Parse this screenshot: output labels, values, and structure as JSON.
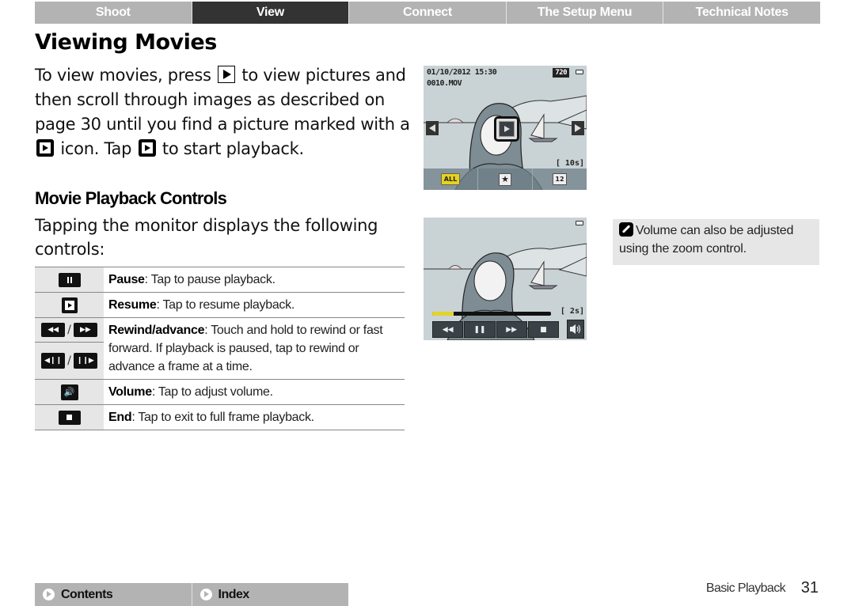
{
  "top_nav": {
    "tabs": [
      {
        "label": "Shoot",
        "active": false
      },
      {
        "label": "View",
        "active": true
      },
      {
        "label": "Connect",
        "active": false
      },
      {
        "label": "The Setup Menu",
        "active": false
      },
      {
        "label": "Technical Notes",
        "active": false
      }
    ]
  },
  "page_title": "Viewing Movies",
  "intro": {
    "part1": "To view movies, press",
    "part2": "to view pictures and then scroll through images as described on page 30 until you find a picture marked with a",
    "part3": "icon. Tap",
    "part4": "to start playback.",
    "icons": [
      "playback-button-icon",
      "movie-icon",
      "movie-icon"
    ]
  },
  "section": {
    "title": "Movie Playback Controls",
    "intro": "Tapping the monitor displays the following controls:"
  },
  "controls": [
    {
      "icon": "pause-icon",
      "name": "Pause",
      "desc": ": Tap to pause playback."
    },
    {
      "icon": "resume-icon",
      "name": "Resume",
      "desc": ": Tap to resume playback."
    },
    {
      "icons": [
        "rewind-icon",
        "advance-icon",
        "frame-back-icon",
        "frame-forward-icon"
      ],
      "name": "Rewind/advance",
      "desc": ": Touch and hold to rewind or fast forward. If playback is paused, tap to rewind or advance a frame at a time.",
      "separator": "/"
    },
    {
      "icon": "volume-icon",
      "name": "Volume",
      "desc": ": Tap to adjust volume."
    },
    {
      "icon": "stop-icon",
      "name": "End",
      "desc": ": Tap to exit to full frame playback."
    }
  ],
  "screen1": {
    "datetime": "01/10/2012 15:30",
    "filename": "0010.MOV",
    "resolution_badge": "720",
    "duration": "[ 10s]",
    "bottom_bar": [
      "ALL",
      "★",
      "12"
    ]
  },
  "screen2": {
    "duration": "[ 2s]",
    "progress_fraction": 0.18,
    "controls": [
      "◀◀",
      "❚❚",
      "▶▶",
      "■"
    ]
  },
  "note": {
    "text": "Volume can also be adjusted using the zoom control."
  },
  "footer": {
    "nav": [
      {
        "label": "Contents"
      },
      {
        "label": "Index"
      }
    ],
    "section": "Basic Playback",
    "page": "31"
  },
  "colors": {
    "tab_bg": "#b3b3b3",
    "tab_active_bg": "#333333",
    "progress_fill": "#e3d42a",
    "note_bg": "#e6e6e6"
  }
}
